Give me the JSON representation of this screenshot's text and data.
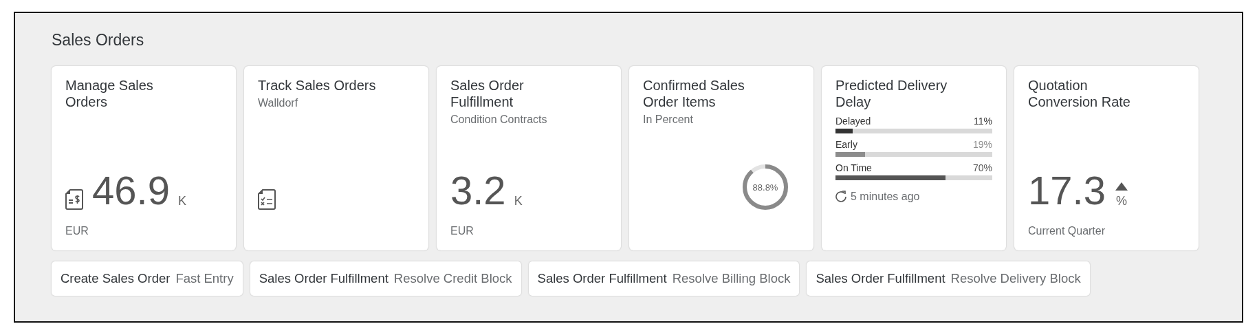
{
  "group_title": "Sales Orders",
  "tiles": [
    {
      "kind": "numeric",
      "title": "Manage Sales Orders",
      "value": "46.9",
      "scale": "K",
      "footer": "EUR"
    },
    {
      "kind": "launch",
      "title": "Track Sales Orders",
      "subtitle": "Walldorf"
    },
    {
      "kind": "numeric",
      "title": "Sales Order Fulfillment",
      "subtitle": "Condition Contracts",
      "value": "3.2",
      "scale": "K",
      "footer": "EUR"
    },
    {
      "kind": "donut",
      "title": "Confirmed Sales Order Items",
      "subtitle": "In Percent",
      "level": 0.888,
      "reading": "88.8%"
    },
    {
      "kind": "bars",
      "title": "Predicted Delivery Delay",
      "bars": [
        {
          "label": "Delayed",
          "reading": "11%",
          "level": 0.11,
          "color": "#333333"
        },
        {
          "label": "Early",
          "reading": "19%",
          "level": 0.19,
          "color": "#8c8c8c"
        },
        {
          "label": "On Time",
          "reading": "70%",
          "level": 0.7,
          "color": "#555555"
        }
      ],
      "footer": "5 minutes ago"
    },
    {
      "kind": "numeric",
      "title": "Quotation Conversion Rate",
      "value": "17.3",
      "scale": "%",
      "trend_up": true,
      "footer": "Current Quarter"
    }
  ],
  "links": [
    {
      "title": "Create Sales Order",
      "subtitle": "Fast Entry"
    },
    {
      "title": "Sales Order Fulfillment",
      "subtitle": "Resolve Credit Block"
    },
    {
      "title": "Sales Order Fulfillment",
      "subtitle": "Resolve Billing Block"
    },
    {
      "title": "Sales Order Fulfillment",
      "subtitle": "Resolve Delivery Block"
    }
  ]
}
